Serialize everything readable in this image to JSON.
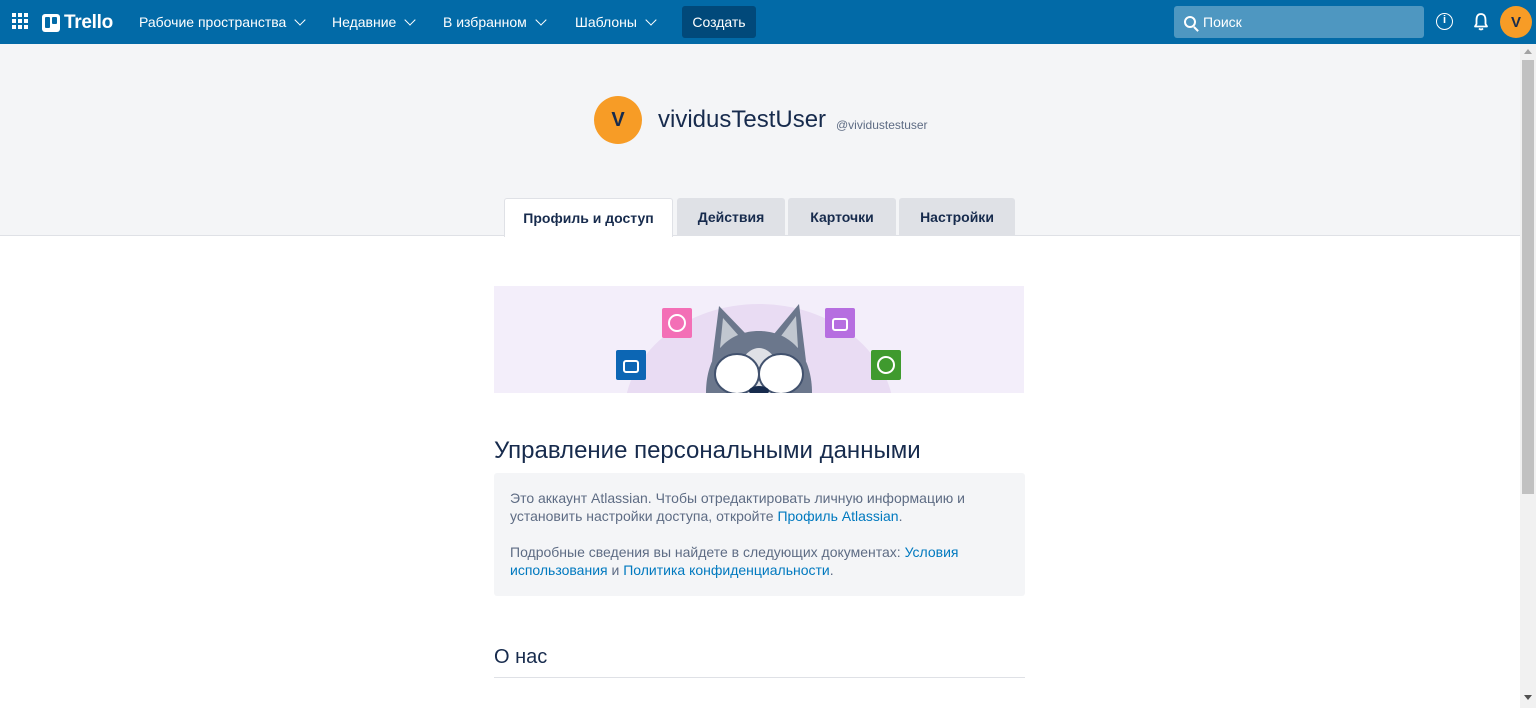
{
  "nav": {
    "brand": "Trello",
    "menus": [
      {
        "label": "Рабочие пространства"
      },
      {
        "label": "Недавние"
      },
      {
        "label": "В избранном"
      },
      {
        "label": "Шаблоны"
      }
    ],
    "create_label": "Создать",
    "search_placeholder": "Поиск",
    "avatar_initial": "V",
    "icons": [
      "apps-grid-icon",
      "trello-logo-icon",
      "search-icon",
      "info-icon",
      "bell-icon"
    ]
  },
  "profile": {
    "avatar_initial": "V",
    "full_name": "vividusTestUser",
    "username": "@vividustestuser"
  },
  "tabs": [
    {
      "label": "Профиль и доступ",
      "active": true
    },
    {
      "label": "Действия",
      "active": false
    },
    {
      "label": "Карточки",
      "active": false
    },
    {
      "label": "Настройки",
      "active": false
    }
  ],
  "content": {
    "heading": "Управление персональными данными",
    "notice_p1_text": "Это аккаунт Atlassian. Чтобы отредактировать личную информацию и установить настройки доступа, откройте",
    "notice_p1_link": "Профиль Atlassian",
    "notice_p1_end": ".",
    "notice_p2_text": "Подробные сведения вы найдете в следующих документах:",
    "notice_p2_link1": "Условия использования",
    "notice_p2_and": "и",
    "notice_p2_link2": "Политика конфиденциальности",
    "notice_p2_end": ".",
    "about_heading": "О нас"
  },
  "colors": {
    "nav_bg": "#026aa7",
    "avatar": "#f79c26",
    "link": "#0079bf"
  }
}
